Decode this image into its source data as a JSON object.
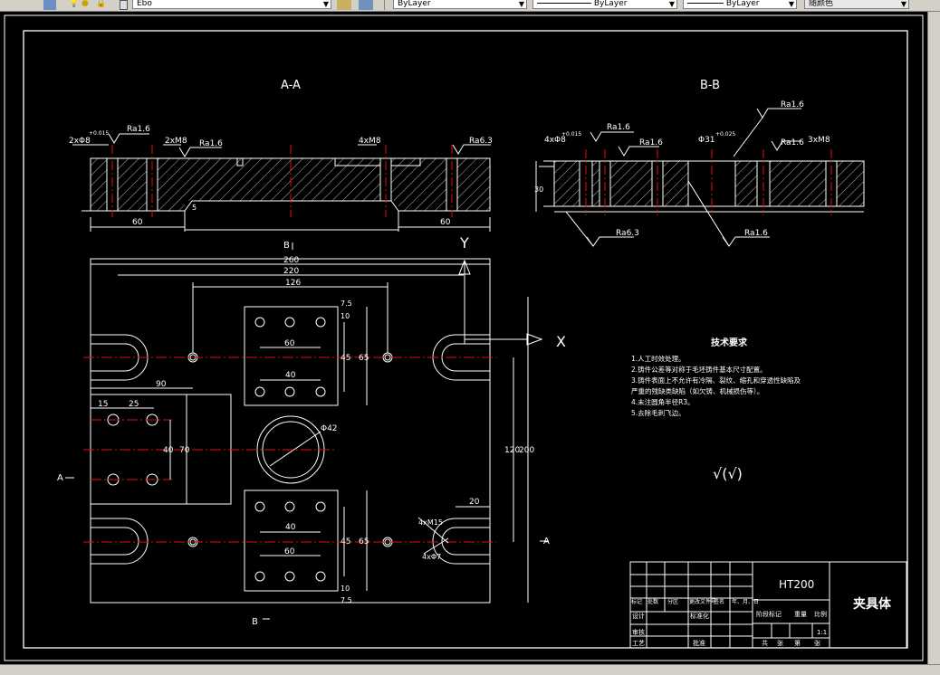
{
  "toolbar": {
    "layer_name": "Ebo",
    "color_value": "ByLayer",
    "linetype_value": "ByLayer",
    "lineweight_value": "ByLayer",
    "plotstyle_value": "随颜色"
  },
  "drawing": {
    "section_aa_title": "A-A",
    "section_bb_title": "B-B",
    "dims": {
      "d_260": "260",
      "d_220": "220",
      "d_126": "126",
      "d_90": "90",
      "d_60a": "60",
      "d_60b": "60",
      "d_60c": "60",
      "d_60d": "60",
      "d_40a": "40",
      "d_40b": "40",
      "d_15": "15",
      "d_25": "25",
      "d_40v": "40",
      "d_70v": "70",
      "d_120": "120",
      "d_200": "200",
      "d_45a": "45",
      "d_65a": "65",
      "d_45b": "45",
      "d_65b": "65",
      "d_10a": "10",
      "d_75a": "7.5",
      "d_10b": "10",
      "d_75b": "7.5",
      "d_20": "20",
      "d_phi42": "Φ42",
      "d_4xm15": "4xM15",
      "d_4x": "4xΦ7",
      "d_30": "30",
      "d_5": "5"
    },
    "labels": {
      "y_axis": "Y",
      "x_axis": "X",
      "a_left": "A",
      "a_right": "A",
      "b_top": "B",
      "b_bottom": "B",
      "aa_2x": "2xΦ8",
      "aa_tol1": "+0.015",
      "aa_ra16a": "Ra1.6",
      "aa_2xm8": "2xM8",
      "aa_ra16b": "Ra1.6",
      "aa_4xm8": "4xM8",
      "aa_ra63": "Ra6.3",
      "bb_4x": "4xΦ8",
      "bb_tol": "+0.015",
      "bb_ra16a": "Ra1.6",
      "bb_ra16b": "Ra1.6",
      "bb_phi": "Φ31",
      "bb_tol2": "+0.025",
      "bb_ra16c": "Ra1.6",
      "bb_ra16d": "Ra1.6",
      "bb_m8": "3xM8",
      "bb_ra63": "Ra6.3",
      "bb_ra16e": "Ra1.6"
    },
    "tech_req": {
      "title": "技术要求",
      "lines": [
        "1.人工时效处理。",
        "2.铸件公差等对称于毛坯铸件基本尺寸配置。",
        "3.铸件表面上不允许有冷隔、裂纹、缩孔和穿透性缺陷及",
        "严重的残缺类缺陷（如欠铸、机械损伤等）。",
        "4.未注圆角半径R3。",
        "5.去除毛刺飞边。"
      ]
    },
    "roughness_note": "√(√)",
    "title_block": {
      "material": "HT200",
      "part_name": "夹具体",
      "scale": "1:1",
      "row_labels": [
        "标记",
        "处数",
        "分区",
        "更改文件号",
        "签名",
        "年、月、日"
      ],
      "designer": "设计",
      "standardize": "标准化",
      "review": "审核",
      "process": "工艺",
      "approve": "批准",
      "stage_mark": "阶段标记",
      "weight": "重量",
      "ratio": "比例",
      "sheets_total": "共",
      "sheet": "张",
      "sheet_no": "第",
      "sheet2": "张"
    }
  }
}
